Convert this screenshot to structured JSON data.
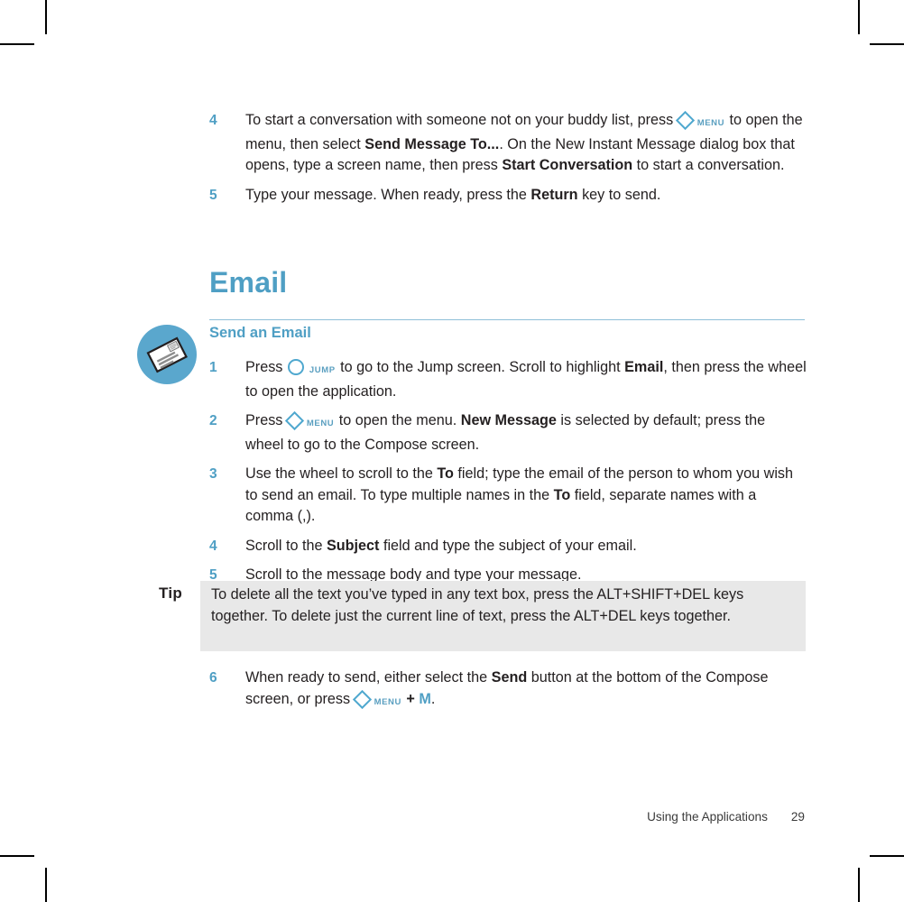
{
  "document": {
    "footer": {
      "section_label": "Using the Applications",
      "page_number": "29"
    }
  },
  "colors": {
    "accent_blue": "#4f9fc4",
    "key_glyph_blue": "#4fa8cf",
    "rule_blue": "#8fbfd8",
    "tip_background": "#e8e8e8",
    "body_text": "#231f20",
    "badge_background": "#5aa7cd"
  },
  "top_steps": [
    {
      "number": "4",
      "text_part_1": "To start a conversation with someone not on your buddy list, press ",
      "key_glyph": "diamond-menu-key",
      "key_label": "MENU",
      "text_part_2": " to open the menu, then select ",
      "bold_1": "Send Message To...",
      "text_part_3": ". On the New Instant Message dialog box that opens, type a screen name, then press ",
      "bold_2": "Start Conversation",
      "text_part_4": " to start a conversation."
    },
    {
      "number": "5",
      "text_part_1": "Type your message. When ready, press the ",
      "bold_1": "Return",
      "text_part_2": " key to send."
    }
  ],
  "section": {
    "title": "Email",
    "subhead": "Send an Email",
    "badge_icon": "envelope-icon"
  },
  "email_steps": [
    {
      "number": "1",
      "text_part_1": "Press ",
      "key_glyph": "circle-jump-key",
      "key_label": "JUMP",
      "text_part_2": " to go to the Jump screen. Scroll to highlight ",
      "bold_1": "Email",
      "text_part_3": ", then press the wheel to open the application."
    },
    {
      "number": "2",
      "text_part_1": "Press ",
      "key_glyph": "diamond-menu-key",
      "key_label": "MENU",
      "text_part_2": " to open the menu. ",
      "bold_1": "New Message",
      "text_part_3": " is selected by default; press the wheel to go to the Compose screen."
    },
    {
      "number": "3",
      "text_part_1": "Use the wheel to scroll to the ",
      "bold_1": "To",
      "text_part_2": " field; type the email of the person to whom you wish to send an email. To type multiple names in the ",
      "bold_2": "To",
      "text_part_3": " field, separate names with a comma (,)."
    },
    {
      "number": "4",
      "text_part_1": "Scroll to the ",
      "bold_1": "Subject",
      "text_part_2": " field and type the subject of your email."
    },
    {
      "number": "5",
      "text_part_1": "Scroll to the message body and type your message."
    }
  ],
  "tip": {
    "label": "Tip",
    "text": "To delete all the text you’ve typed in any text box, press the ALT+SHIFT+DEL keys together. To delete just the current line of text, press the ALT+DEL keys together."
  },
  "final_step": {
    "number": "6",
    "text_part_1": "When ready to send, either select the ",
    "bold_1": "Send",
    "text_part_2": " button at the bottom of the Compose screen, or press ",
    "key_glyph": "diamond-menu-key",
    "key_label": "MENU",
    "text_part_3": " + ",
    "accent": "M",
    "text_part_4": "."
  }
}
